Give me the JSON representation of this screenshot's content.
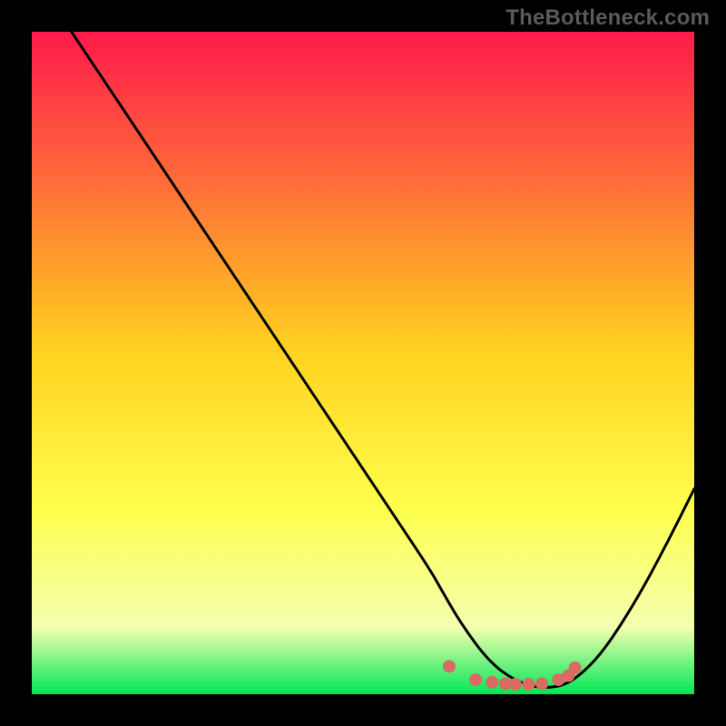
{
  "watermark": "TheBottleneck.com",
  "colors": {
    "frame": "#000000",
    "gradient_top": "#ff1a4b",
    "gradient_mid_upper": "#ff6a3a",
    "gradient_mid": "#ffd21f",
    "gradient_mid_lower": "#ffff4d",
    "gradient_lower": "#f3ffb0",
    "gradient_bottom": "#00e756",
    "curve": "#000000",
    "markers": "#d96b62"
  },
  "chart_data": {
    "type": "line",
    "title": "",
    "xlabel": "",
    "ylabel": "",
    "xlim": [
      0,
      100
    ],
    "ylim": [
      0,
      100
    ],
    "grid": false,
    "series": [
      {
        "name": "bottleneck-curve",
        "x": [
          6,
          10,
          15,
          20,
          25,
          30,
          35,
          40,
          45,
          50,
          55,
          60,
          62,
          64,
          66,
          68,
          70,
          72,
          74,
          76,
          78,
          80,
          82,
          85,
          88,
          92,
          96,
          100
        ],
        "y": [
          100,
          94,
          86.5,
          79,
          71.5,
          64,
          56.5,
          49,
          41.5,
          34,
          26.5,
          19,
          15.5,
          12,
          9,
          6.3,
          4.2,
          2.7,
          1.7,
          1.1,
          1.0,
          1.3,
          2.3,
          5.0,
          9.0,
          15.5,
          23.0,
          31.0
        ]
      }
    ],
    "markers": {
      "name": "highlight-dots",
      "points": [
        {
          "x": 63,
          "y": 4.2
        },
        {
          "x": 67,
          "y": 2.2
        },
        {
          "x": 69.5,
          "y": 1.8
        },
        {
          "x": 71.5,
          "y": 1.6
        },
        {
          "x": 73,
          "y": 1.5
        },
        {
          "x": 75,
          "y": 1.5
        },
        {
          "x": 77,
          "y": 1.6
        },
        {
          "x": 79.5,
          "y": 2.2
        },
        {
          "x": 81,
          "y": 2.8
        },
        {
          "x": 82,
          "y": 4.0
        }
      ]
    }
  }
}
